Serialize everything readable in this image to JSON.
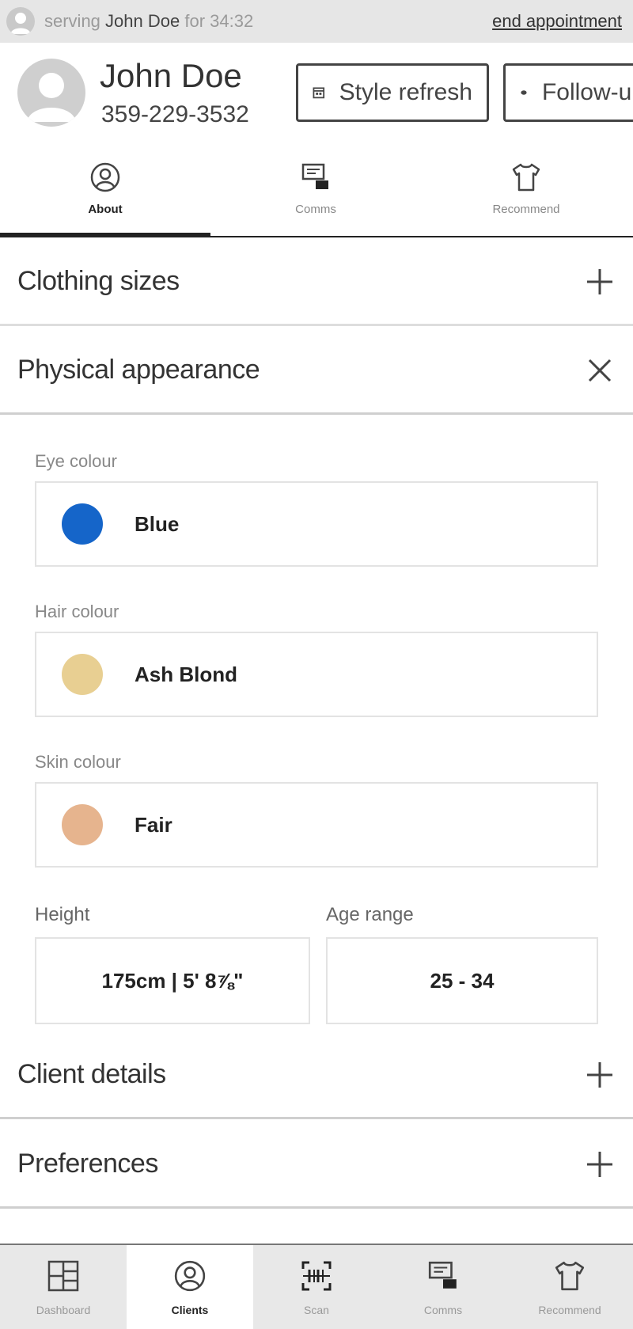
{
  "serving_bar": {
    "prefix": "serving",
    "client_name": "John Doe",
    "suffix": "for 34:32",
    "end_label": "end appointment"
  },
  "client": {
    "name": "John Doe",
    "phone": "359-229-3532"
  },
  "header_buttons": {
    "style_refresh": "Style refresh",
    "follow_up": "Follow-up"
  },
  "tabs": [
    {
      "label": "About",
      "icon": "user-circle-icon",
      "active": true
    },
    {
      "label": "Comms",
      "icon": "chat-icon",
      "active": false
    },
    {
      "label": "Recommend",
      "icon": "tshirt-icon",
      "active": false
    }
  ],
  "sections": {
    "clothing_sizes": "Clothing sizes",
    "physical_appearance": "Physical appearance",
    "client_details": "Client details",
    "preferences": "Preferences"
  },
  "appearance": {
    "eye": {
      "label": "Eye colour",
      "value": "Blue",
      "color": "#1565c9"
    },
    "hair": {
      "label": "Hair colour",
      "value": "Ash Blond",
      "color": "#e8cf92"
    },
    "skin": {
      "label": "Skin colour",
      "value": "Fair",
      "color": "#e6b48e"
    },
    "height": {
      "label": "Height",
      "value": "175cm  |  5' 8⅞\""
    },
    "age": {
      "label": "Age range",
      "value": "25 - 34"
    }
  },
  "bottom_nav": [
    {
      "label": "Dashboard",
      "icon": "dashboard-icon",
      "active": false
    },
    {
      "label": "Clients",
      "icon": "user-circle-icon",
      "active": true
    },
    {
      "label": "Scan",
      "icon": "scan-icon",
      "active": false
    },
    {
      "label": "Comms",
      "icon": "chat-icon",
      "active": false
    },
    {
      "label": "Recommend",
      "icon": "tshirt-icon",
      "active": false
    }
  ]
}
